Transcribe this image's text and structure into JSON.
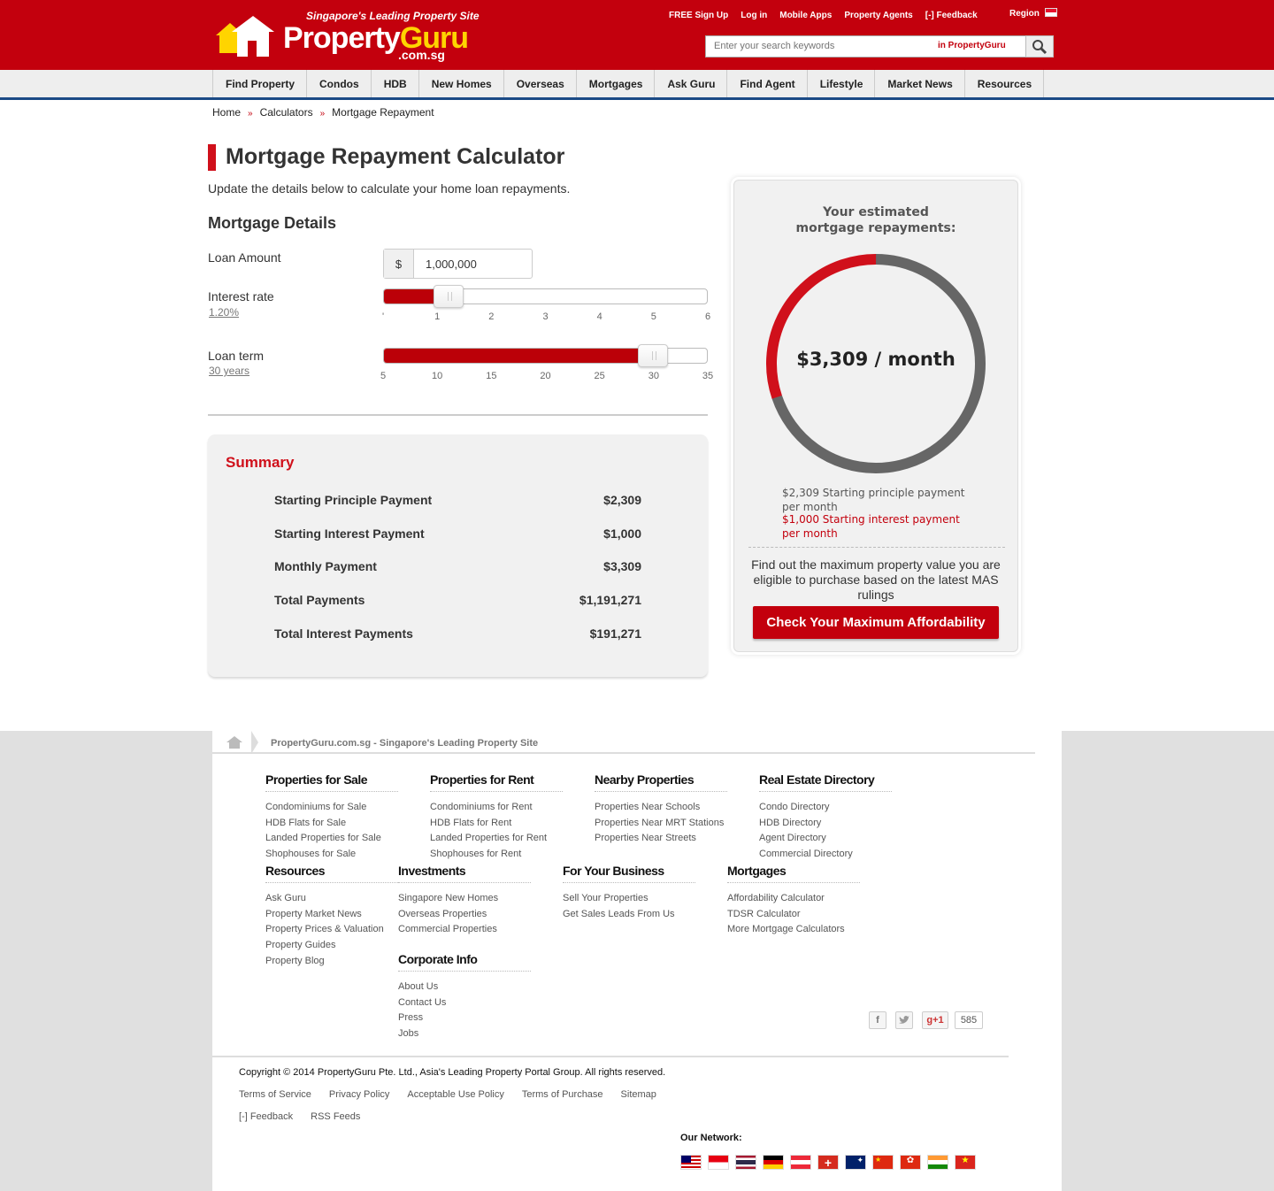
{
  "header": {
    "tagline": "Singapore's Leading Property Site",
    "logo_property": "Property",
    "logo_guru": "Guru",
    "logo_domain": ".com.sg",
    "toplinks": [
      "FREE Sign Up",
      "Log in",
      "Mobile Apps",
      "Property Agents",
      "[-] Feedback"
    ],
    "region": "Region",
    "search_placeholder": "Enter your search keywords",
    "search_scope": "in PropertyGuru"
  },
  "nav": [
    "Find Property",
    "Condos",
    "HDB",
    "New Homes",
    "Overseas",
    "Mortgages",
    "Ask Guru",
    "Find Agent",
    "Lifestyle",
    "Market News",
    "Resources"
  ],
  "breadcrumb": [
    "Home",
    "Calculators",
    "Mortgage Repayment"
  ],
  "breadcrumb_sep": "»",
  "page": {
    "title": "Mortgage Repayment Calculator",
    "subtitle": "Update the details below to calculate your home loan repayments.",
    "section": "Mortgage Details"
  },
  "form": {
    "loan_amount_label": "Loan Amount",
    "currency": "$",
    "loan_amount": "1,000,000",
    "interest_label": "Interest rate",
    "interest_value": "1.20%",
    "interest_level": 0.2,
    "interest_ticks": [
      "'",
      "1",
      "2",
      "3",
      "4",
      "5",
      "6"
    ],
    "term_label": "Loan term",
    "term_value": "30 years",
    "term_level": 0.833,
    "term_ticks": [
      "5",
      "10",
      "15",
      "20",
      "25",
      "30",
      "35"
    ]
  },
  "summary": {
    "title": "Summary",
    "rows": [
      {
        "label": "Starting Principle Payment",
        "value": "$2,309"
      },
      {
        "label": "Starting Interest Payment",
        "value": "$1,000"
      },
      {
        "label": "Monthly Payment",
        "value": "$3,309"
      },
      {
        "label": "Total Payments",
        "value": "$1,191,271"
      },
      {
        "label": "Total Interest Payments",
        "value": "$191,271"
      }
    ]
  },
  "result": {
    "heading": "Your estimated mortgage repayments:",
    "monthly": "$3,309 / month",
    "principal_share": 0.698,
    "interest_share": 0.302,
    "principal_note": "$2,309 Starting principle payment per month",
    "interest_note": "$1,000 Starting interest payment per month",
    "affordability_note": "Find out the maximum property value you are eligible to purchase based on the latest MAS rulings",
    "cta": "Check Your Maximum Affordability",
    "colors": {
      "principal": "#666666",
      "interest": "#d0101b"
    }
  },
  "footer": {
    "breadcrumb": "PropertyGuru.com.sg - Singapore's Leading Property Site",
    "columns": [
      {
        "title": "Properties for Sale",
        "items": [
          "Condominiums for Sale",
          "HDB Flats for Sale",
          "Landed Properties for Sale",
          "Shophouses for Sale"
        ]
      },
      {
        "title": "Properties for Rent",
        "items": [
          "Condominiums for Rent",
          "HDB Flats for Rent",
          "Landed Properties for Rent",
          "Shophouses for Rent"
        ]
      },
      {
        "title": "Nearby Properties",
        "items": [
          "Properties Near Schools",
          "Properties Near MRT Stations",
          "Properties Near Streets"
        ]
      },
      {
        "title": "Real Estate Directory",
        "items": [
          "Condo Directory",
          "HDB Directory",
          "Agent Directory",
          "Commercial Directory"
        ]
      },
      {
        "title": "Resources",
        "items": [
          "Ask Guru",
          "Property Market News",
          "Property Prices & Valuation",
          "Property Guides",
          "Property Blog"
        ]
      },
      {
        "title": "Investments",
        "items": [
          "Singapore New Homes",
          "Overseas Properties",
          "Commercial Properties"
        ]
      },
      {
        "title": "For Your Business",
        "items": [
          "Sell Your Properties",
          "Get Sales Leads From Us"
        ]
      },
      {
        "title": "Mortgages",
        "items": [
          "Affordability Calculator",
          "TDSR Calculator",
          "More Mortgage Calculators"
        ]
      },
      {
        "title": "Corporate Info",
        "items": [
          "About Us",
          "Contact Us",
          "Press",
          "Jobs"
        ]
      }
    ],
    "social_count": "585",
    "gplus": "g+1",
    "copyright": "Copyright © 2014 PropertyGuru Pte. Ltd., Asia's Leading Property Portal Group. All rights reserved.",
    "links": [
      "Terms of Service",
      "Privacy Policy",
      "Acceptable Use Policy",
      "Terms of Purchase",
      "Sitemap"
    ],
    "links2": [
      "[-] Feedback",
      "RSS Feeds"
    ],
    "network_label": "Our Network:",
    "network_flags": [
      "malaysia",
      "indonesia",
      "thailand",
      "germany",
      "austria",
      "switzerland",
      "australia",
      "china",
      "hong-kong",
      "india",
      "vietnam"
    ]
  }
}
